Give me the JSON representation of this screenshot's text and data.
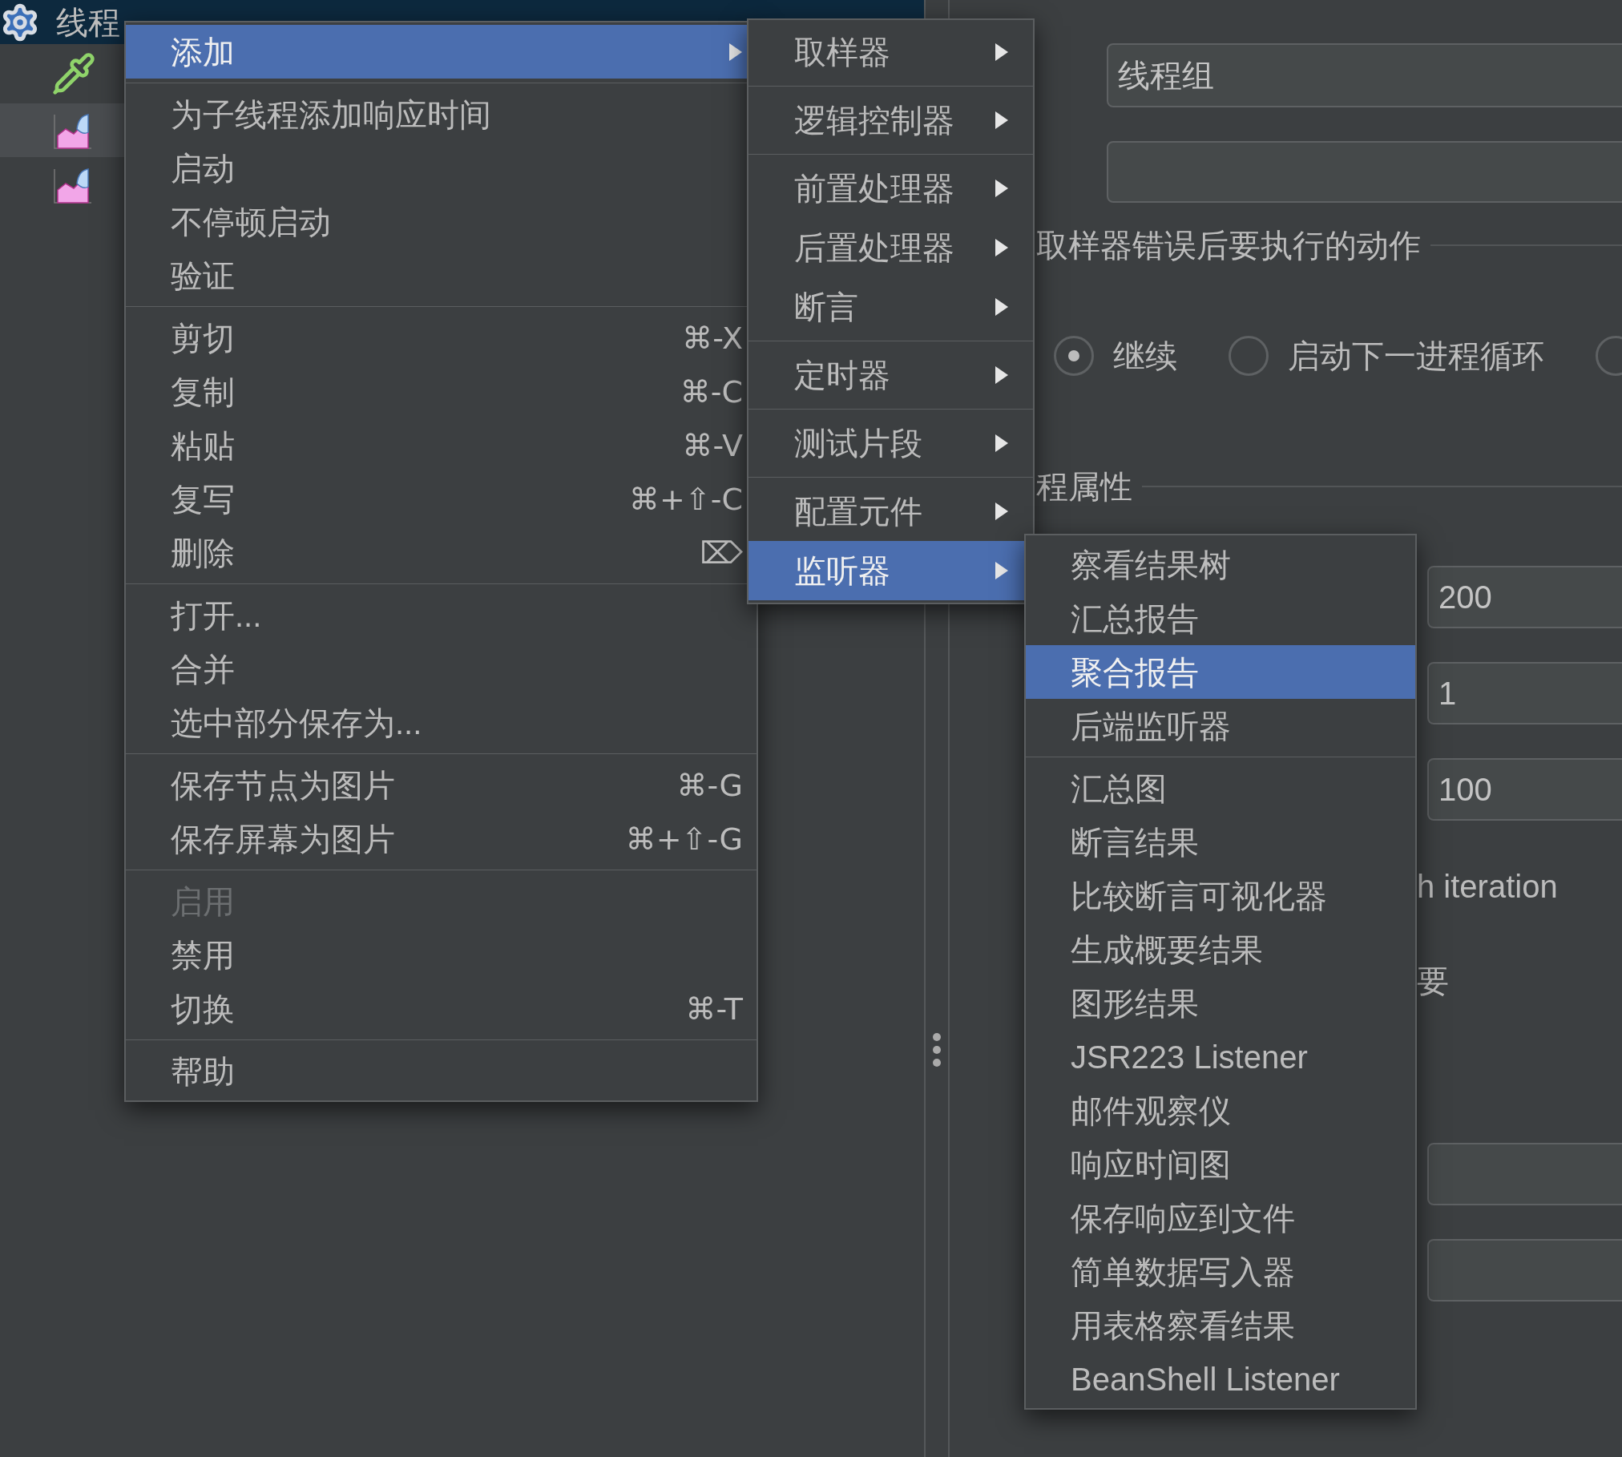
{
  "tree": {
    "items": [
      {
        "kind": "thread-group",
        "label": "线程",
        "selected": true,
        "highlighted": false
      },
      {
        "kind": "sampler",
        "selected": false,
        "highlighted": false
      },
      {
        "kind": "listener",
        "selected": false,
        "highlighted": true
      },
      {
        "kind": "listener",
        "selected": false,
        "highlighted": false
      }
    ]
  },
  "context_menu": {
    "groups": [
      {
        "items": [
          {
            "label": "添加",
            "submenu": true,
            "selected": true,
            "disabled": false
          }
        ]
      },
      {
        "items": [
          {
            "label": "为子线程添加响应时间",
            "submenu": false,
            "selected": false,
            "disabled": false
          },
          {
            "label": "启动",
            "submenu": false,
            "selected": false,
            "disabled": false
          },
          {
            "label": "不停顿启动",
            "submenu": false,
            "selected": false,
            "disabled": false
          },
          {
            "label": "验证",
            "submenu": false,
            "selected": false,
            "disabled": false
          }
        ]
      },
      {
        "items": [
          {
            "label": "剪切",
            "shortcut": "⌘-X",
            "submenu": false,
            "selected": false,
            "disabled": false
          },
          {
            "label": "复制",
            "shortcut": "⌘-C",
            "submenu": false,
            "selected": false,
            "disabled": false
          },
          {
            "label": "粘贴",
            "shortcut": "⌘-V",
            "submenu": false,
            "selected": false,
            "disabled": false
          },
          {
            "label": "复写",
            "shortcut": "⌘+⇧-C",
            "submenu": false,
            "selected": false,
            "disabled": false
          },
          {
            "label": "删除",
            "shortcut": "⌦",
            "submenu": false,
            "selected": false,
            "disabled": false
          }
        ]
      },
      {
        "items": [
          {
            "label": "打开...",
            "submenu": false,
            "selected": false,
            "disabled": false
          },
          {
            "label": "合并",
            "submenu": false,
            "selected": false,
            "disabled": false
          },
          {
            "label": "选中部分保存为...",
            "submenu": false,
            "selected": false,
            "disabled": false
          }
        ]
      },
      {
        "items": [
          {
            "label": "保存节点为图片",
            "shortcut": "⌘-G",
            "submenu": false,
            "selected": false,
            "disabled": false
          },
          {
            "label": "保存屏幕为图片",
            "shortcut": "⌘+⇧-G",
            "submenu": false,
            "selected": false,
            "disabled": false
          }
        ]
      },
      {
        "items": [
          {
            "label": "启用",
            "submenu": false,
            "selected": false,
            "disabled": true
          },
          {
            "label": "禁用",
            "submenu": false,
            "selected": false,
            "disabled": false
          },
          {
            "label": "切换",
            "shortcut": "⌘-T",
            "submenu": false,
            "selected": false,
            "disabled": false
          }
        ]
      },
      {
        "items": [
          {
            "label": "帮助",
            "submenu": false,
            "selected": false,
            "disabled": false
          }
        ]
      }
    ]
  },
  "add_submenu": {
    "groups": [
      {
        "items": [
          {
            "label": "取样器",
            "submenu": true,
            "selected": false,
            "disabled": false
          }
        ]
      },
      {
        "items": [
          {
            "label": "逻辑控制器",
            "submenu": true,
            "selected": false,
            "disabled": false
          }
        ]
      },
      {
        "items": [
          {
            "label": "前置处理器",
            "submenu": true,
            "selected": false,
            "disabled": false
          },
          {
            "label": "后置处理器",
            "submenu": true,
            "selected": false,
            "disabled": false
          },
          {
            "label": "断言",
            "submenu": true,
            "selected": false,
            "disabled": false
          }
        ]
      },
      {
        "items": [
          {
            "label": "定时器",
            "submenu": true,
            "selected": false,
            "disabled": false
          }
        ]
      },
      {
        "items": [
          {
            "label": "测试片段",
            "submenu": true,
            "selected": false,
            "disabled": false
          }
        ]
      },
      {
        "items": [
          {
            "label": "配置元件",
            "submenu": true,
            "selected": false,
            "disabled": false
          },
          {
            "label": "监听器",
            "submenu": true,
            "selected": true,
            "disabled": false
          }
        ]
      }
    ]
  },
  "listener_submenu": {
    "groups": [
      {
        "items": [
          {
            "label": "察看结果树",
            "submenu": false,
            "selected": false,
            "disabled": false
          },
          {
            "label": "汇总报告",
            "submenu": false,
            "selected": false,
            "disabled": false
          },
          {
            "label": "聚合报告",
            "submenu": false,
            "selected": true,
            "disabled": false
          },
          {
            "label": "后端监听器",
            "submenu": false,
            "selected": false,
            "disabled": false
          }
        ]
      },
      {
        "items": [
          {
            "label": "汇总图",
            "submenu": false,
            "selected": false,
            "disabled": false
          },
          {
            "label": "断言结果",
            "submenu": false,
            "selected": false,
            "disabled": false
          },
          {
            "label": "比较断言可视化器",
            "submenu": false,
            "selected": false,
            "disabled": false
          },
          {
            "label": "生成概要结果",
            "submenu": false,
            "selected": false,
            "disabled": false
          },
          {
            "label": "图形结果",
            "submenu": false,
            "selected": false,
            "disabled": false
          },
          {
            "label": "JSR223 Listener",
            "submenu": false,
            "selected": false,
            "disabled": false
          },
          {
            "label": "邮件观察仪",
            "submenu": false,
            "selected": false,
            "disabled": false
          },
          {
            "label": "响应时间图",
            "submenu": false,
            "selected": false,
            "disabled": false
          },
          {
            "label": "保存响应到文件",
            "submenu": false,
            "selected": false,
            "disabled": false
          },
          {
            "label": "简单数据写入器",
            "submenu": false,
            "selected": false,
            "disabled": false
          },
          {
            "label": "用表格察看结果",
            "submenu": false,
            "selected": false,
            "disabled": false
          },
          {
            "label": "BeanShell Listener",
            "submenu": false,
            "selected": false,
            "disabled": false
          }
        ]
      }
    ]
  },
  "thread_group_panel": {
    "name_field": {
      "value": "线程组"
    },
    "error_action": {
      "heading": "取样器错误后要执行的动作",
      "options": [
        {
          "label": "继续",
          "selected": true
        },
        {
          "label": "启动下一进程循环",
          "selected": false
        },
        {
          "selected": false
        }
      ]
    },
    "properties": {
      "heading": "程属性",
      "fields": [
        {
          "value": "200"
        },
        {
          "value": "1"
        },
        {
          "value": "100"
        }
      ],
      "fragments": [
        "h iteration",
        "要"
      ]
    }
  }
}
